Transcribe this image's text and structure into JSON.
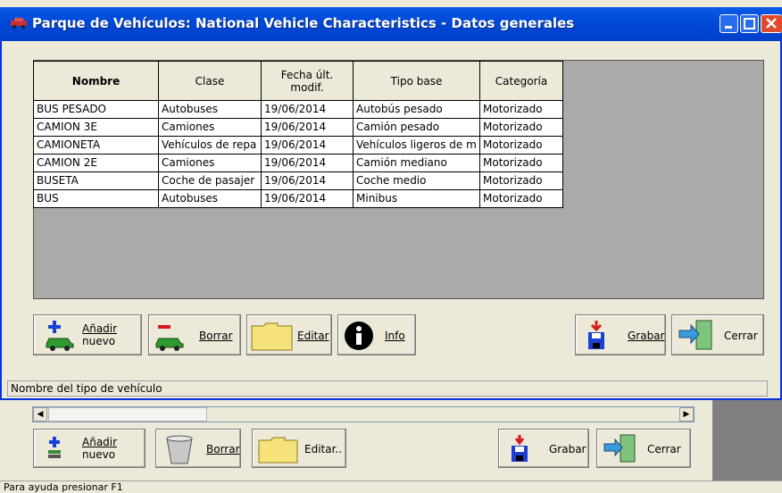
{
  "dialog": {
    "title": "Parque de Vehículos: National Vehicle Characteristics - Datos generales",
    "status_text": "Nombre del tipo de vehículo"
  },
  "grid": {
    "headers": [
      "Nombre",
      "Clase",
      "Fecha últ. modif.",
      "Tipo base",
      "Categoría"
    ],
    "rows": [
      [
        "BUS PESADO",
        "Autobuses",
        "19/06/2014",
        "Autobús pesado",
        "Motorizado"
      ],
      [
        "CAMION 3E",
        "Camiones",
        "19/06/2014",
        "Camión pesado",
        "Motorizado"
      ],
      [
        "CAMIONETA",
        "Vehículos de repa",
        "19/06/2014",
        "Vehículos ligeros de m",
        "Motorizado"
      ],
      [
        "CAMION 2E",
        "Camiones",
        "19/06/2014",
        "Camión mediano",
        "Motorizado"
      ],
      [
        "BUSETA",
        "Coche de pasajer",
        "19/06/2014",
        "Coche medio",
        "Motorizado"
      ],
      [
        "BUS",
        "Autobuses",
        "19/06/2014",
        "Minibus",
        "Motorizado"
      ]
    ]
  },
  "toolbar": {
    "add_line1": "Añadir",
    "add_line2": "nuevo",
    "delete": "Borrar",
    "edit": "Editar",
    "info": "Info",
    "save": "Grabar",
    "close": "Cerrar"
  },
  "background_window": {
    "add_line1": "Añadir",
    "add_line2": "nuevo",
    "delete": "Borrar",
    "edit": "Editar..",
    "save": "Grabar",
    "close": "Cerrar",
    "status_text": "Para ayuda presionar F1"
  },
  "colors": {
    "titlebar": "#0049d8",
    "grid_background": "#abaaa9",
    "window_face": "#ece9d8"
  }
}
